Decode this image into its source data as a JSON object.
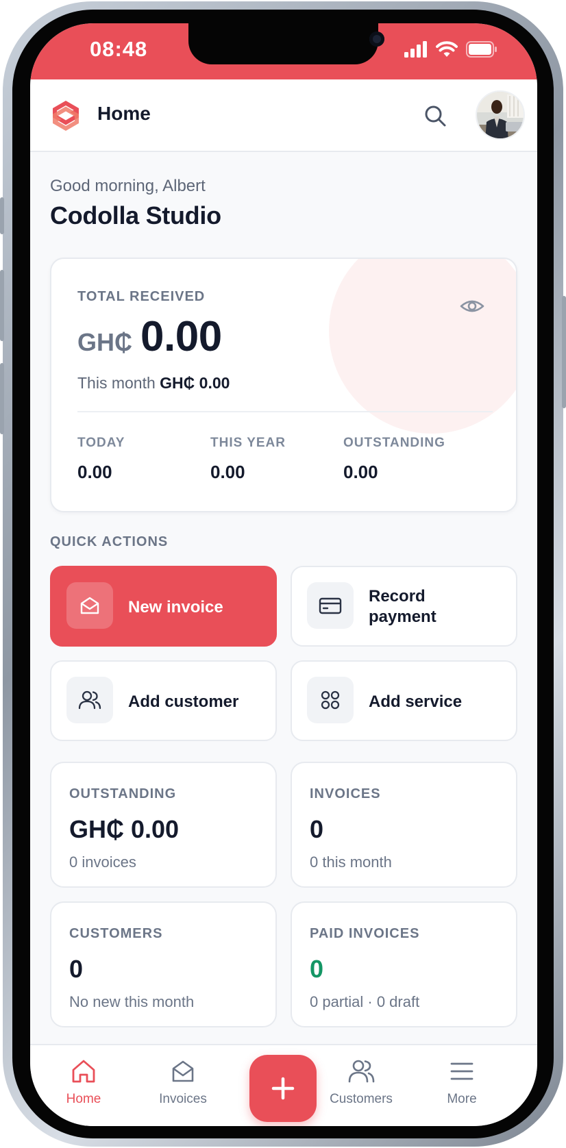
{
  "status_bar": {
    "time": "08:48",
    "icons": [
      "cellular-signal-icon",
      "wifi-icon",
      "battery-icon"
    ]
  },
  "app_bar": {
    "logo_icon": "app-logo-icon",
    "title": "Home",
    "search_icon": "search-icon",
    "avatar": "user-avatar"
  },
  "header": {
    "greeting": "Good morning, Albert",
    "business_name": "Codolla Studio"
  },
  "total_card": {
    "label": "TOTAL RECEIVED",
    "currency": "GH₵",
    "amount": "0.00",
    "month_label": "This month",
    "month_value": "GH₵ 0.00",
    "toggle_icon": "eye-icon",
    "stats": [
      {
        "label": "TODAY",
        "value": "0.00"
      },
      {
        "label": "THIS YEAR",
        "value": "0.00"
      },
      {
        "label": "OUTSTANDING",
        "value": "0.00"
      }
    ]
  },
  "quick_actions": {
    "title": "QUICK ACTIONS",
    "items": [
      {
        "label": "New invoice",
        "icon": "envelope-open-icon"
      },
      {
        "label_line1": "Record",
        "label_line2": "payment",
        "icon": "credit-card-icon"
      },
      {
        "label": "Add customer",
        "icon": "users-icon"
      },
      {
        "label": "Add service",
        "icon": "grid-icon"
      }
    ]
  },
  "summary": [
    {
      "label": "OUTSTANDING",
      "value": "GH₵ 0.00",
      "sub": "0 invoices"
    },
    {
      "label": "INVOICES",
      "value": "0",
      "sub": "0 this month"
    },
    {
      "label": "CUSTOMERS",
      "value": "0",
      "sub": "No new this month"
    },
    {
      "label": "PAID INVOICES",
      "value": "0",
      "sub": "0 partial · 0 draft"
    }
  ],
  "bottom_nav": {
    "items": [
      {
        "label": "Home",
        "icon": "home-icon",
        "active": true
      },
      {
        "label": "Invoices",
        "icon": "envelope-open-icon"
      },
      {
        "label": "Customers",
        "icon": "users-icon"
      },
      {
        "label": "More",
        "icon": "menu-icon"
      }
    ],
    "fab_icon": "plus-icon"
  },
  "colors": {
    "accent": "#e94f58",
    "text_primary": "#141a2c",
    "text_secondary": "#6b7587",
    "success": "#149665",
    "background": "#f8f9fb"
  }
}
